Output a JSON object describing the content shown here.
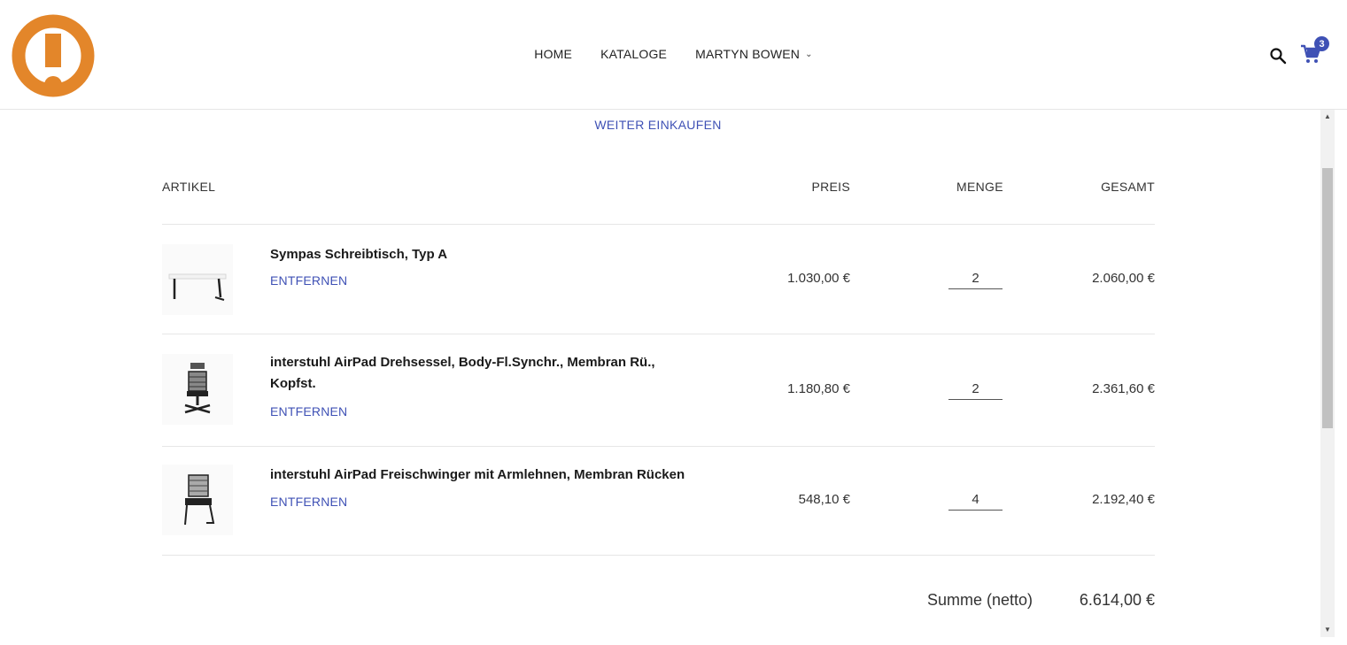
{
  "header": {
    "nav": [
      {
        "label": "HOME"
      },
      {
        "label": "KATALOGE"
      },
      {
        "label": "MARTYN BOWEN"
      }
    ],
    "cart_count": "3",
    "accent_color": "#3f51b5",
    "logo_color": "#e3862a",
    "icons": [
      "logo-icon",
      "search-icon",
      "cart-icon",
      "chevron-down-icon"
    ]
  },
  "cart": {
    "continue_label": "WEITER EINKAUFEN",
    "columns": {
      "article": "ARTIKEL",
      "price": "PREIS",
      "quantity": "MENGE",
      "total": "GESAMT"
    },
    "remove_label": "ENTFERNEN",
    "items": [
      {
        "name": "Sympas Schreibtisch, Typ A",
        "price": "1.030,00 €",
        "quantity": "2",
        "total": "2.060,00 €",
        "image": "desk-image"
      },
      {
        "name": "interstuhl AirPad Drehsessel, Body-Fl.Synchr., Membran Rü., Kopfst.",
        "price": "1.180,80 €",
        "quantity": "2",
        "total": "2.361,60 €",
        "image": "swivel-chair-image"
      },
      {
        "name": "interstuhl AirPad Freischwinger mit Armlehnen, Membran Rücken",
        "price": "548,10 €",
        "quantity": "4",
        "total": "2.192,40 €",
        "image": "cantilever-chair-image"
      }
    ],
    "summary": {
      "label": "Summe (netto)",
      "value": "6.614,00 €"
    }
  }
}
